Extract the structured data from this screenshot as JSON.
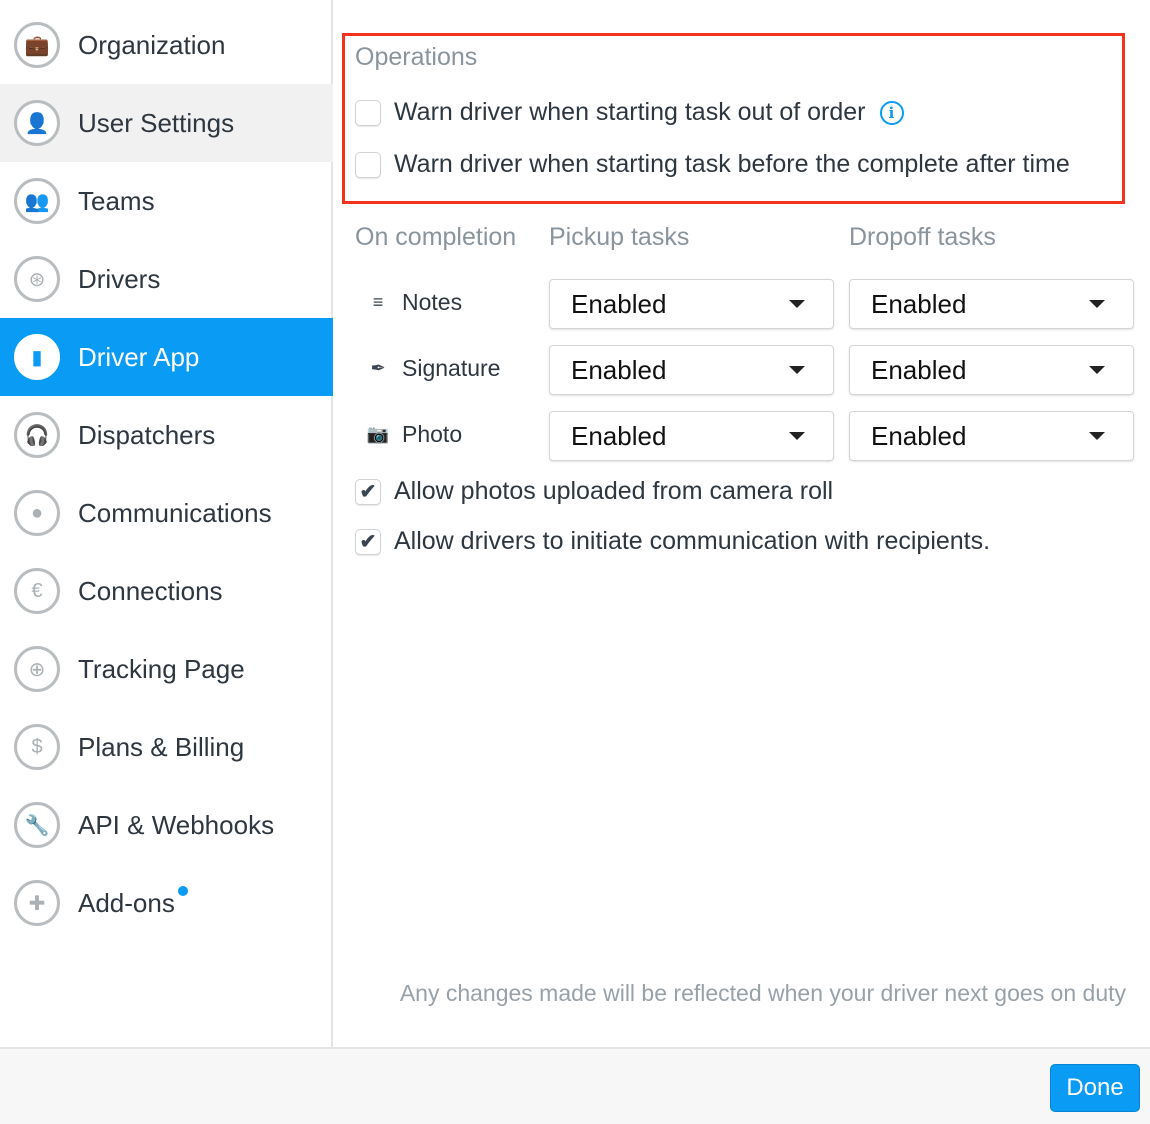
{
  "sidebar": {
    "items": [
      {
        "label": "Organization",
        "icon": "briefcase-icon",
        "glyph": "💼"
      },
      {
        "label": "User Settings",
        "icon": "user-icon",
        "glyph": "👤"
      },
      {
        "label": "Teams",
        "icon": "team-icon",
        "glyph": "👥"
      },
      {
        "label": "Drivers",
        "icon": "steering-wheel-icon",
        "glyph": "⊛"
      },
      {
        "label": "Driver App",
        "icon": "phone-icon",
        "glyph": "▮"
      },
      {
        "label": "Dispatchers",
        "icon": "headset-icon",
        "glyph": "🎧"
      },
      {
        "label": "Communications",
        "icon": "chat-bubble-icon",
        "glyph": "●"
      },
      {
        "label": "Connections",
        "icon": "connection-icon",
        "glyph": "€"
      },
      {
        "label": "Tracking Page",
        "icon": "crosshair-icon",
        "glyph": "⊕"
      },
      {
        "label": "Plans & Billing",
        "icon": "dollar-icon",
        "glyph": "$"
      },
      {
        "label": "API & Webhooks",
        "icon": "wrench-icon",
        "glyph": "🔧"
      },
      {
        "label": "Add-ons",
        "icon": "puzzle-icon",
        "glyph": "✚"
      }
    ],
    "active": "Driver App",
    "hovered": "User Settings"
  },
  "operations": {
    "title": "Operations",
    "options": [
      {
        "label": "Warn driver when starting task out of order",
        "checked": false,
        "info": "i"
      },
      {
        "label": "Warn driver when starting task before the complete after time",
        "checked": false
      }
    ]
  },
  "completion": {
    "headers": [
      "On completion",
      "Pickup tasks",
      "Dropoff tasks"
    ],
    "rows": [
      {
        "label": "Notes",
        "icon": "lines-icon",
        "glyph": "≡",
        "pickup": "Enabled",
        "dropoff": "Enabled"
      },
      {
        "label": "Signature",
        "icon": "signature-icon",
        "glyph": "✒",
        "pickup": "Enabled",
        "dropoff": "Enabled"
      },
      {
        "label": "Photo",
        "icon": "camera-icon",
        "glyph": "📷",
        "pickup": "Enabled",
        "dropoff": "Enabled"
      }
    ]
  },
  "checks": [
    {
      "label": "Allow photos uploaded from camera roll",
      "checked": true,
      "mark": "✔"
    },
    {
      "label": "Allow drivers to initiate communication with recipients.",
      "checked": true,
      "mark": "✔"
    }
  ],
  "note": "Any changes made will be reflected when your driver next goes on duty",
  "footer": {
    "done": "Done"
  },
  "colors": {
    "accent": "#0a9bf5",
    "highlight": "#f4331f"
  }
}
